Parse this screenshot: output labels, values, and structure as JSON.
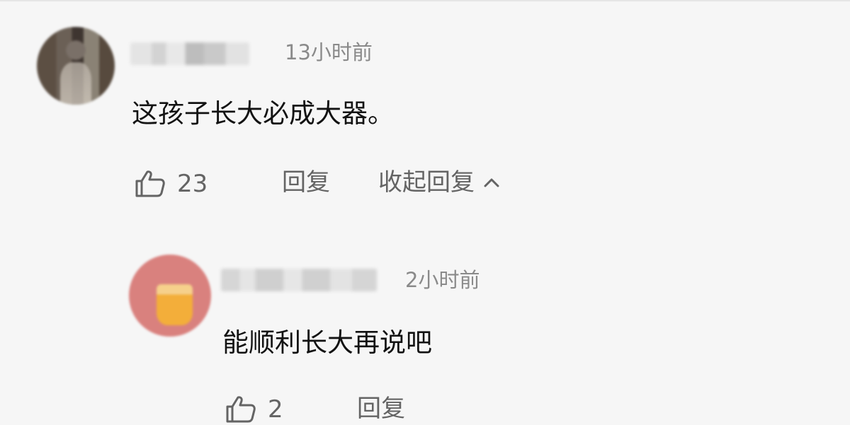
{
  "comments": [
    {
      "username": "",
      "time": "13小时前",
      "text": "这孩子长大必成大器。",
      "likes": "23",
      "reply_label": "回复",
      "collapse_label": "收起回复"
    }
  ],
  "replies": [
    {
      "username": "",
      "time": "2小时前",
      "text": "能顺利长大再说吧",
      "likes": "2",
      "reply_label": "回复"
    }
  ],
  "icons": {
    "like": "thumbs-up-icon",
    "collapse": "chevron-up-icon"
  },
  "colors": {
    "background": "#f6f6f6",
    "text": "#121212",
    "meta": "#8a8a8a",
    "action": "#646464"
  }
}
